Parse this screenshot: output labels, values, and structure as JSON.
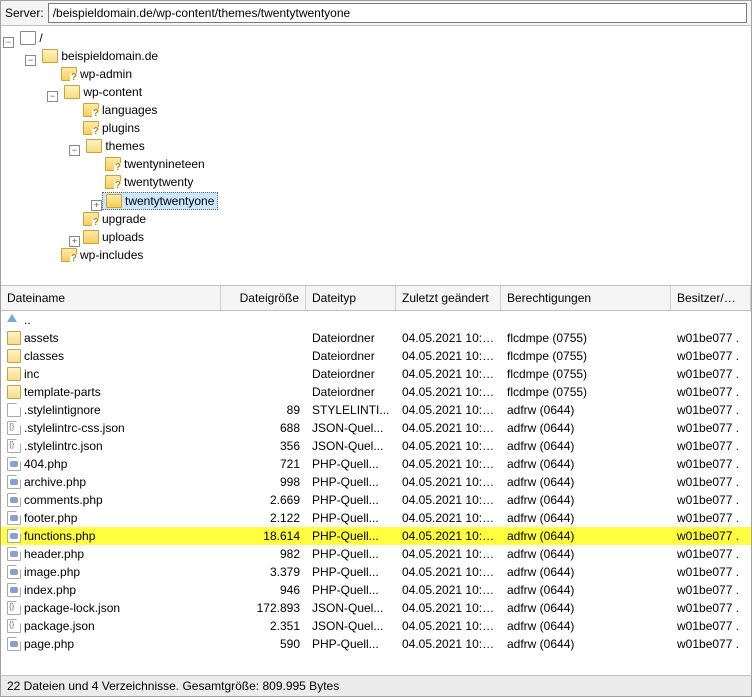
{
  "toolbar": {
    "server_label": "Server:",
    "path": "/beispieldomain.de/wp-content/themes/twentytwentyone"
  },
  "tree": {
    "root": "/",
    "domain": "beispieldomain.de",
    "wp_admin": "wp-admin",
    "wp_content": "wp-content",
    "languages": "languages",
    "plugins": "plugins",
    "themes": "themes",
    "twentynineteen": "twentynineteen",
    "twentytwenty": "twentytwenty",
    "twentytwentyone": "twentytwentyone",
    "upgrade": "upgrade",
    "uploads": "uploads",
    "wp_includes": "wp-includes"
  },
  "columns": {
    "name": "Dateiname",
    "size": "Dateigröße",
    "type": "Dateityp",
    "date": "Zuletzt geändert",
    "perm": "Berechtigungen",
    "owner": "Besitzer/Gr..."
  },
  "files": [
    {
      "icon": "up",
      "name": "..",
      "size": "",
      "type": "",
      "date": "",
      "perm": "",
      "owner": ""
    },
    {
      "icon": "folder",
      "name": "assets",
      "size": "",
      "type": "Dateiordner",
      "date": "04.05.2021 10:5...",
      "perm": "flcdmpe (0755)",
      "owner": "w01be077 ."
    },
    {
      "icon": "folder",
      "name": "classes",
      "size": "",
      "type": "Dateiordner",
      "date": "04.05.2021 10:5...",
      "perm": "flcdmpe (0755)",
      "owner": "w01be077 ."
    },
    {
      "icon": "folder",
      "name": "inc",
      "size": "",
      "type": "Dateiordner",
      "date": "04.05.2021 10:5...",
      "perm": "flcdmpe (0755)",
      "owner": "w01be077 ."
    },
    {
      "icon": "folder",
      "name": "template-parts",
      "size": "",
      "type": "Dateiordner",
      "date": "04.05.2021 10:5...",
      "perm": "flcdmpe (0755)",
      "owner": "w01be077 ."
    },
    {
      "icon": "file",
      "name": ".stylelintignore",
      "size": "89",
      "type": "STYLELINTI...",
      "date": "04.05.2021 10:5...",
      "perm": "adfrw (0644)",
      "owner": "w01be077 ."
    },
    {
      "icon": "json",
      "name": ".stylelintrc-css.json",
      "size": "688",
      "type": "JSON-Quel...",
      "date": "04.05.2021 10:5...",
      "perm": "adfrw (0644)",
      "owner": "w01be077 ."
    },
    {
      "icon": "json",
      "name": ".stylelintrc.json",
      "size": "356",
      "type": "JSON-Quel...",
      "date": "04.05.2021 10:5...",
      "perm": "adfrw (0644)",
      "owner": "w01be077 ."
    },
    {
      "icon": "php",
      "name": "404.php",
      "size": "721",
      "type": "PHP-Quell...",
      "date": "04.05.2021 10:5...",
      "perm": "adfrw (0644)",
      "owner": "w01be077 ."
    },
    {
      "icon": "php",
      "name": "archive.php",
      "size": "998",
      "type": "PHP-Quell...",
      "date": "04.05.2021 10:5...",
      "perm": "adfrw (0644)",
      "owner": "w01be077 ."
    },
    {
      "icon": "php",
      "name": "comments.php",
      "size": "2.669",
      "type": "PHP-Quell...",
      "date": "04.05.2021 10:5...",
      "perm": "adfrw (0644)",
      "owner": "w01be077 ."
    },
    {
      "icon": "php",
      "name": "footer.php",
      "size": "2.122",
      "type": "PHP-Quell...",
      "date": "04.05.2021 10:5...",
      "perm": "adfrw (0644)",
      "owner": "w01be077 ."
    },
    {
      "icon": "php",
      "name": "functions.php",
      "size": "18.614",
      "type": "PHP-Quell...",
      "date": "04.05.2021 10:5...",
      "perm": "adfrw (0644)",
      "owner": "w01be077 .",
      "highlight": true
    },
    {
      "icon": "php",
      "name": "header.php",
      "size": "982",
      "type": "PHP-Quell...",
      "date": "04.05.2021 10:5...",
      "perm": "adfrw (0644)",
      "owner": "w01be077 ."
    },
    {
      "icon": "php",
      "name": "image.php",
      "size": "3.379",
      "type": "PHP-Quell...",
      "date": "04.05.2021 10:5...",
      "perm": "adfrw (0644)",
      "owner": "w01be077 ."
    },
    {
      "icon": "php",
      "name": "index.php",
      "size": "946",
      "type": "PHP-Quell...",
      "date": "04.05.2021 10:5...",
      "perm": "adfrw (0644)",
      "owner": "w01be077 ."
    },
    {
      "icon": "json",
      "name": "package-lock.json",
      "size": "172.893",
      "type": "JSON-Quel...",
      "date": "04.05.2021 10:5...",
      "perm": "adfrw (0644)",
      "owner": "w01be077 ."
    },
    {
      "icon": "json",
      "name": "package.json",
      "size": "2.351",
      "type": "JSON-Quel...",
      "date": "04.05.2021 10:5...",
      "perm": "adfrw (0644)",
      "owner": "w01be077 ."
    },
    {
      "icon": "php",
      "name": "page.php",
      "size": "590",
      "type": "PHP-Quell...",
      "date": "04.05.2021 10:5...",
      "perm": "adfrw (0644)",
      "owner": "w01be077 ."
    }
  ],
  "status": "22 Dateien und 4 Verzeichnisse. Gesamtgröße: 809.995 Bytes"
}
